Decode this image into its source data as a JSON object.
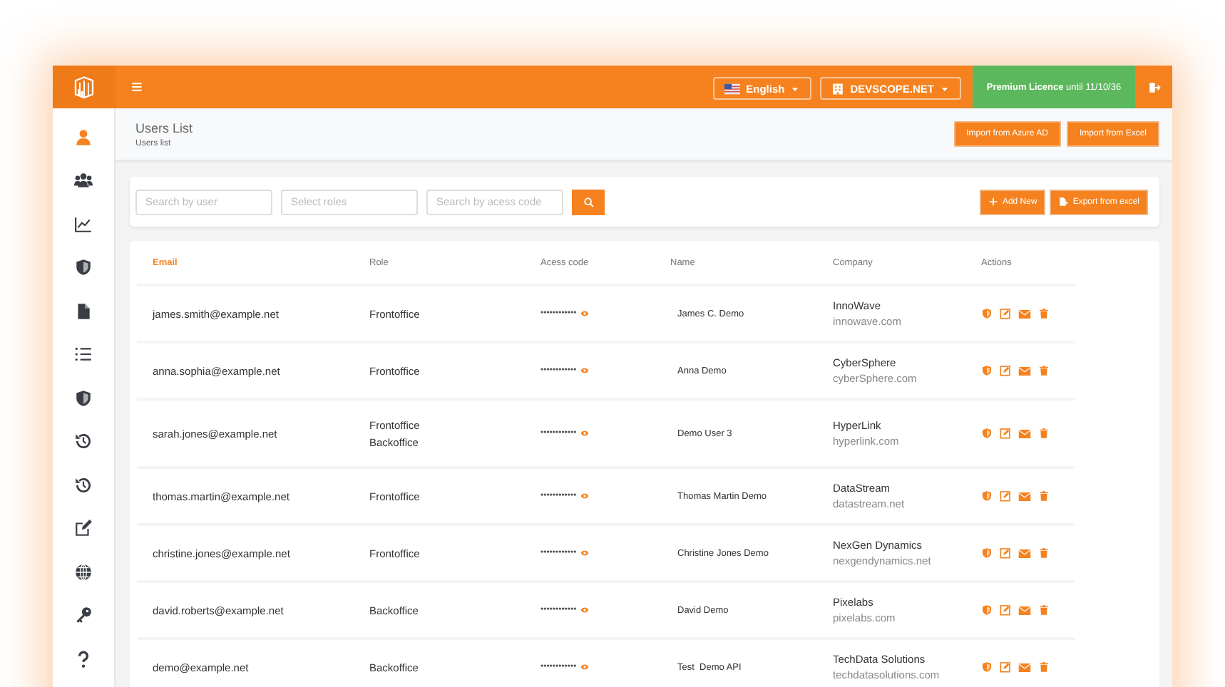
{
  "topbar": {
    "language": "English",
    "organization": "DEVSCOPE.NET",
    "licence": "**Premium Licence** until 11/10/36"
  },
  "sidebar": {
    "items": [
      {
        "kind": "user",
        "selected": true
      },
      {
        "kind": "users",
        "selected": false
      },
      {
        "kind": "chart",
        "selected": false
      },
      {
        "kind": "shield",
        "selected": false
      },
      {
        "kind": "file",
        "selected": false
      },
      {
        "kind": "list",
        "selected": false
      },
      {
        "kind": "shield",
        "selected": false
      },
      {
        "kind": "history",
        "selected": false
      },
      {
        "kind": "history",
        "selected": false
      },
      {
        "kind": "edit",
        "selected": false
      },
      {
        "kind": "globe",
        "selected": false
      },
      {
        "kind": "key",
        "selected": false
      },
      {
        "kind": "help",
        "selected": false
      }
    ]
  },
  "header": {
    "title": "Users List",
    "breadcrumb": "Users list",
    "buttons": [
      "Import from Azure AD",
      "Import from Excel"
    ]
  },
  "filters": {
    "fields": [
      {
        "placeholder": "Search by user"
      },
      {
        "placeholder": "Select roles"
      },
      {
        "placeholder": "Search by acess code"
      }
    ],
    "buttons": [
      {
        "kind": "add",
        "label": "Add New"
      },
      {
        "kind": "export",
        "label": "Export from excel"
      }
    ]
  },
  "table": {
    "columns": [
      {
        "label": "Email",
        "sorted": true
      },
      {
        "label": "Role",
        "sorted": false
      },
      {
        "label": "Acess code",
        "sorted": false
      },
      {
        "label": "Name",
        "sorted": false
      },
      {
        "label": "Company",
        "sorted": false
      },
      {
        "label": "Actions",
        "sorted": false
      }
    ],
    "rows": [
      {
        "email": "james.smith@example.net",
        "roles": [
          "Frontoffice"
        ],
        "access_code": "••••••••••••",
        "name": "James C. Demo",
        "company": "InnoWave",
        "domain": "innowave.com"
      },
      {
        "email": "anna.sophia@example.net",
        "roles": [
          "Frontoffice"
        ],
        "access_code": "••••••••••••",
        "name": "Anna Demo",
        "company": "CyberSphere",
        "domain": "cyberSphere.com"
      },
      {
        "email": "sarah.jones@example.net",
        "roles": [
          "Frontoffice",
          "Backoffice"
        ],
        "access_code": "••••••••••••",
        "name": "Demo User 3",
        "company": "HyperLink",
        "domain": "hyperlink.com"
      },
      {
        "email": "thomas.martin@example.net",
        "roles": [
          "Frontoffice"
        ],
        "access_code": "••••••••••••",
        "name": "Thomas Martin Demo",
        "company": "DataStream",
        "domain": "datastream.net"
      },
      {
        "email": "christine.jones@example.net",
        "roles": [
          "Frontoffice"
        ],
        "access_code": "••••••••••••",
        "name": "Christine Jones Demo",
        "company": "NexGen Dynamics",
        "domain": "nexgendynamics.net"
      },
      {
        "email": "david.roberts@example.net",
        "roles": [
          "Backoffice"
        ],
        "access_code": "••••••••••••",
        "name": "David Demo",
        "company": "Pixelabs",
        "domain": "pixelabs.com"
      },
      {
        "email": "demo@example.net",
        "roles": [
          "Backoffice"
        ],
        "access_code": "••••••••••••",
        "name": "Test  Demo API",
        "company": "TechData Solutions",
        "domain": "techdatasolutions.com"
      }
    ]
  }
}
